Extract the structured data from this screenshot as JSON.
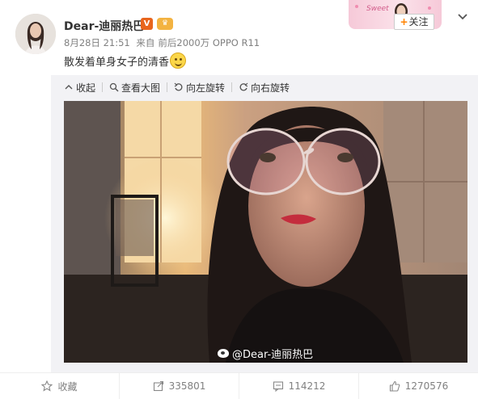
{
  "author": {
    "name": "Dear-迪丽热巴",
    "verified_badge": "V",
    "crown_badge": "♛"
  },
  "post": {
    "date": "8月28日 21:51",
    "source_prefix": "来自",
    "source": "前后2000万 OPPO R11",
    "text": "散发着单身女子的清香",
    "emoji": "smile-emoji"
  },
  "follow": {
    "label": "关注",
    "plus": "+",
    "banner_deco": "Sweet"
  },
  "toolbar": {
    "collapse": "收起",
    "view_large": "查看大图",
    "rotate_left": "向左旋转",
    "rotate_right": "向右旋转"
  },
  "photo": {
    "watermark": "@Dear-迪丽热巴"
  },
  "actions": {
    "favorite": "收藏",
    "repost": "335801",
    "comment": "114212",
    "like": "1270576"
  },
  "colors": {
    "accent": "#ff8200",
    "text_muted": "#808080",
    "verified": "#e8651d"
  }
}
